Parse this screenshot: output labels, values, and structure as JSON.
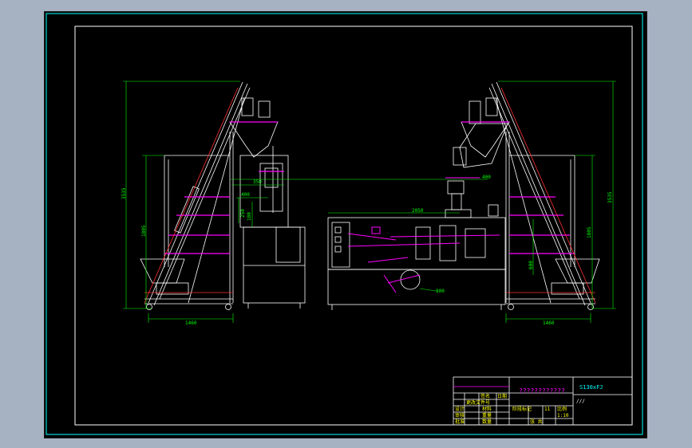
{
  "drawing": {
    "colors": {
      "background": "#000000",
      "frame": "#ffffff",
      "outer_frame": "#00ffff",
      "geometry": "#ffffff",
      "dimension": "#00ff00",
      "accent": "#ff00ff",
      "centerline": "#ff3030",
      "highlight": "#ffff00",
      "canvas_surround": "#a6b2c2"
    },
    "dimensions": {
      "left_total_height": "3535",
      "left_mid_height": "1805",
      "left_base_width": "1460",
      "left_head_a": "350",
      "left_head_b": "400",
      "left_head_c": "250",
      "left_head_d": "180",
      "center_length": "2050",
      "center_offset": "400",
      "center_lower": "800",
      "right_total_height": "3535",
      "right_mid_height": "1805",
      "right_base_width": "1460",
      "right_side": "600"
    },
    "title_block": {
      "drawing_title": "????????????",
      "drawing_number": "S130xFJ",
      "sub_note": "///",
      "scale_label": "比例",
      "sheet_label": "张 共",
      "design_label": "设计",
      "check_label": "审核",
      "weight_label": "重量",
      "count_label": "数量",
      "material_label": "材料",
      "approve_label": "批准",
      "stage_label": "阶段标记",
      "sheet_num": "11",
      "scale_val": "1:10",
      "date_label": "日期",
      "name_label": "签名",
      "file_label": "更改文件号"
    }
  }
}
